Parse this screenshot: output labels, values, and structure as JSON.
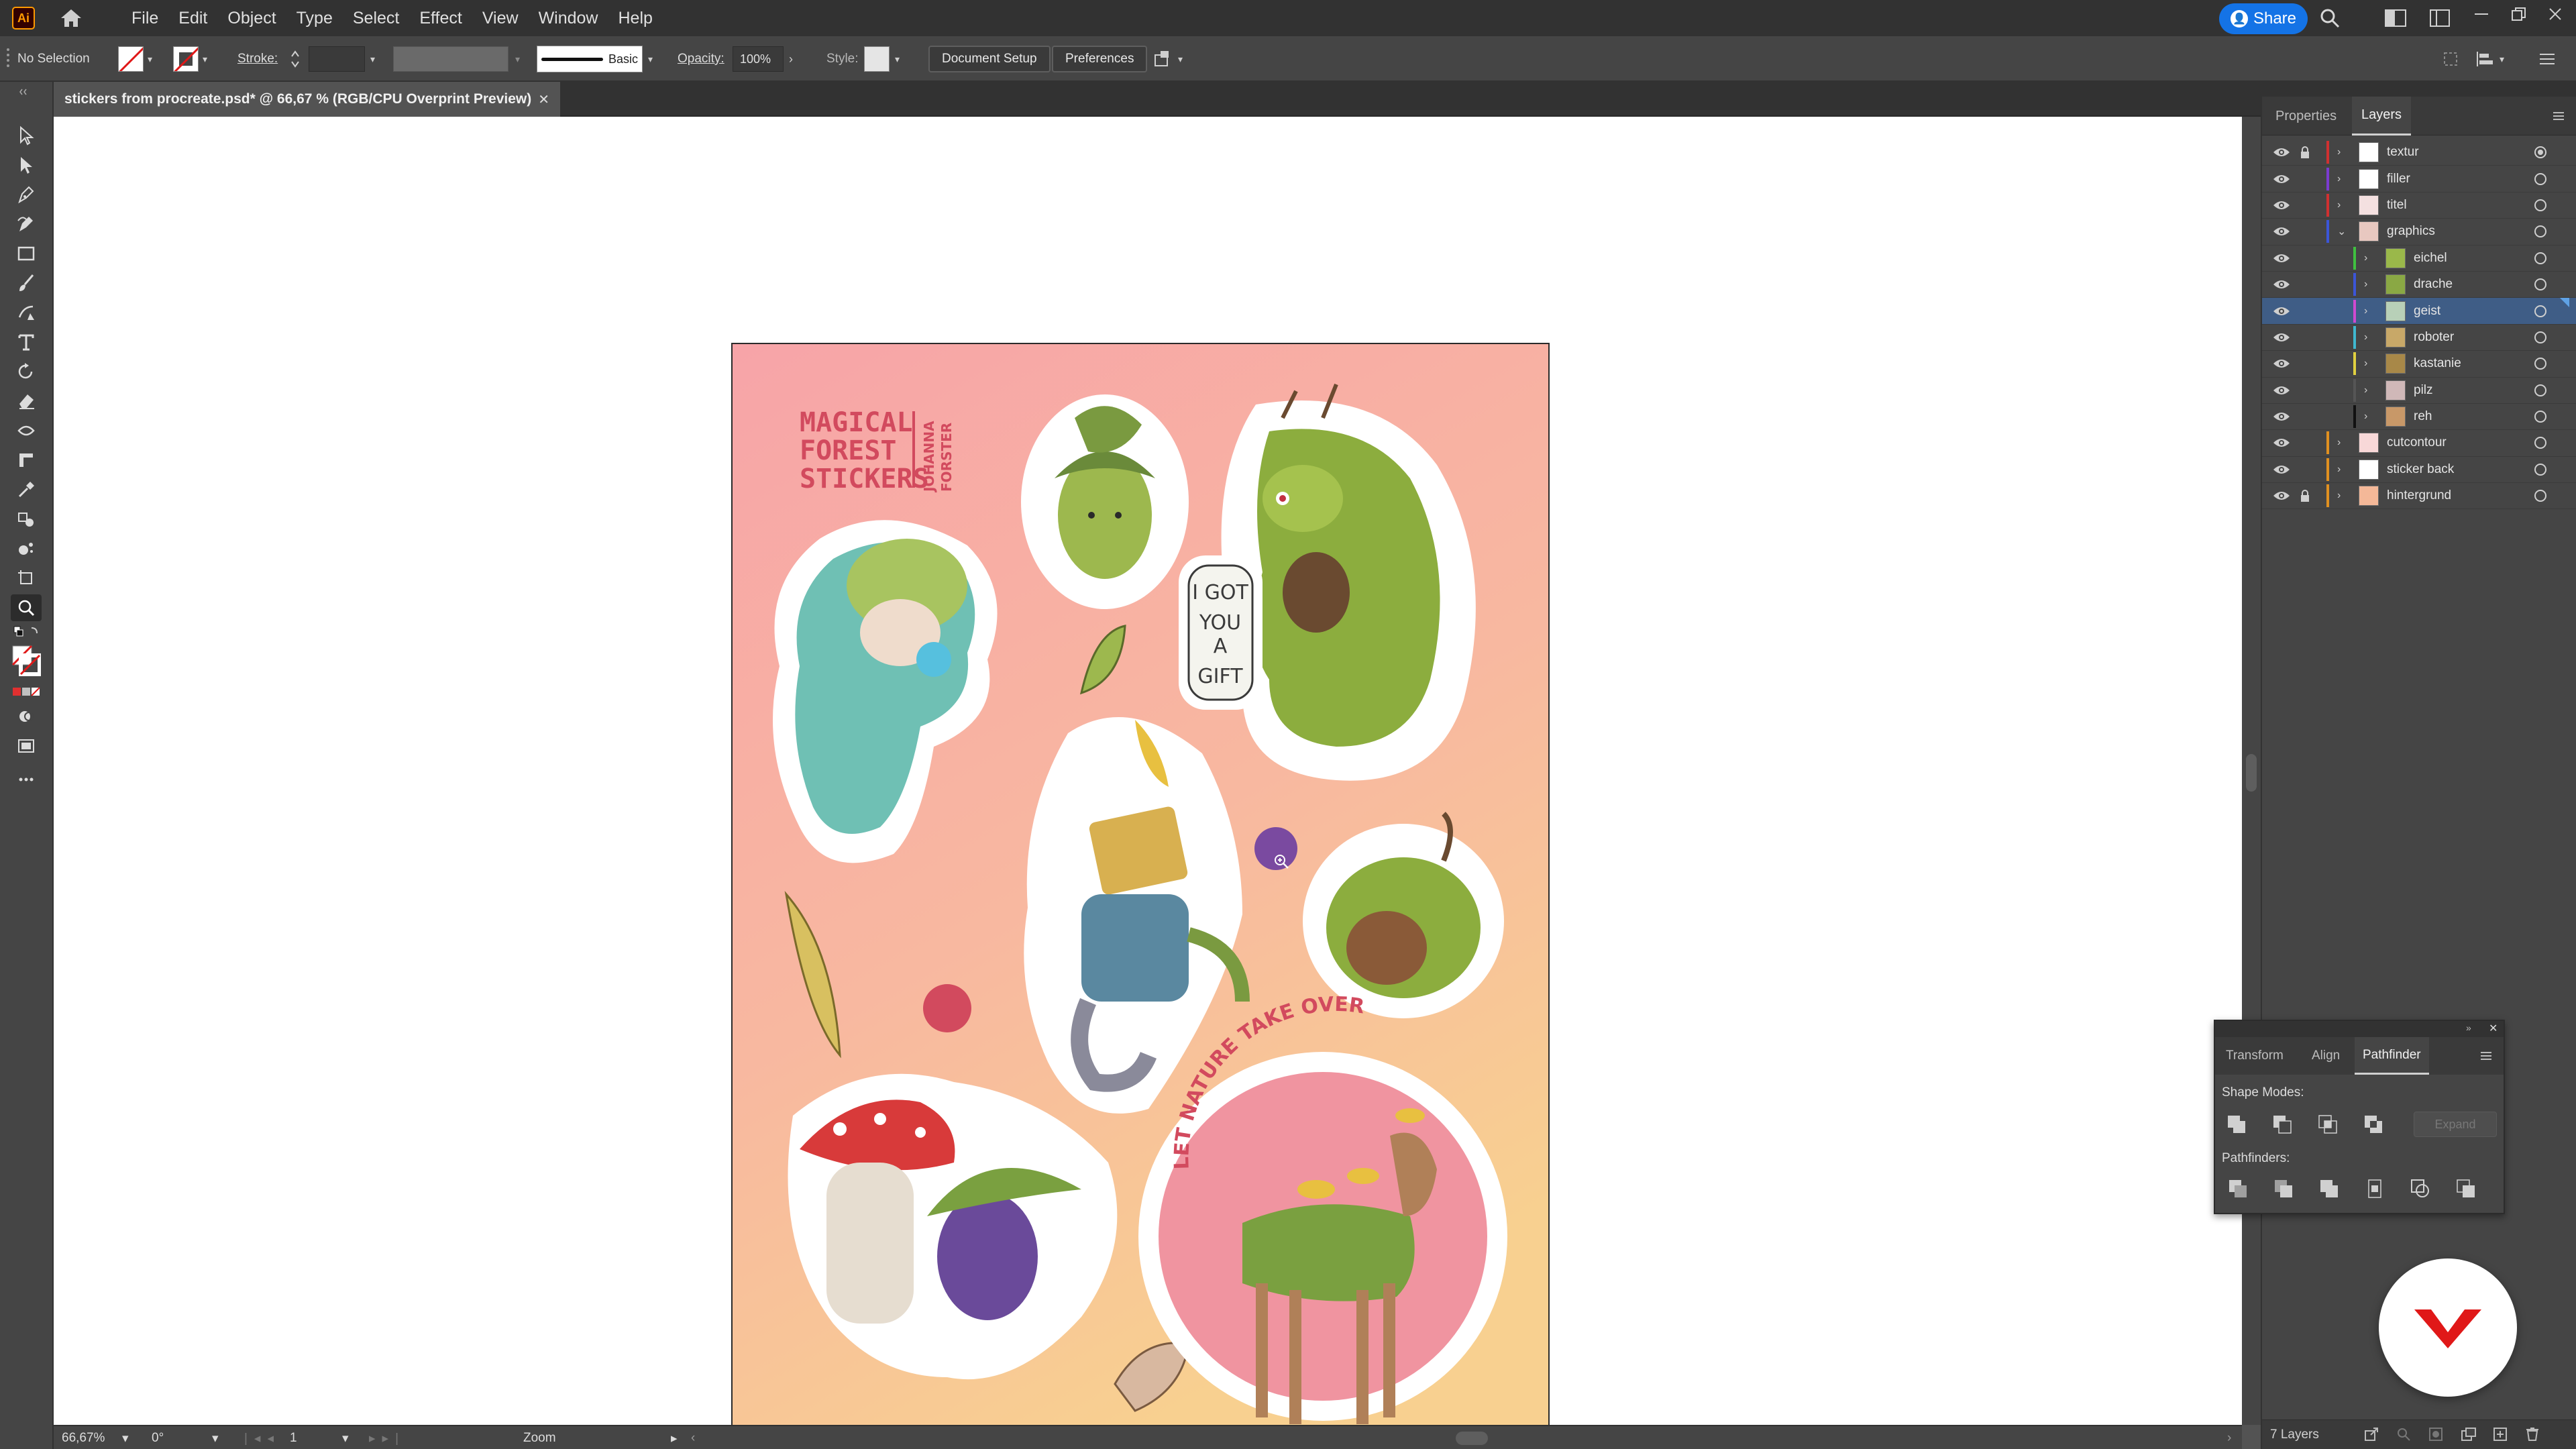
{
  "app": {
    "logo_text": "Ai"
  },
  "menu": [
    "File",
    "Edit",
    "Object",
    "Type",
    "Select",
    "Effect",
    "View",
    "Window",
    "Help"
  ],
  "share": {
    "label": "Share"
  },
  "control_bar": {
    "selection": "No Selection",
    "stroke_label": "Stroke:",
    "brush_label": "Basic",
    "opacity_label": "Opacity:",
    "opacity_value": "100%",
    "style_label": "Style:",
    "document_setup": "Document Setup",
    "preferences": "Preferences"
  },
  "document": {
    "tab_title": "stickers from procreate.psd* @ 66,67 % (RGB/CPU Overprint Preview)",
    "close": "✕"
  },
  "artwork": {
    "title_lines": [
      "MAGICAL",
      "FOREST",
      "STICKERS"
    ],
    "signature_lines": [
      "JOHANNA",
      "FORSTER"
    ],
    "speech_lines": [
      "I GOT",
      "YOU",
      "A",
      "GIFT"
    ],
    "banner": "LET NATURE TAKE OVER"
  },
  "status": {
    "zoom": "66,67%",
    "rotation": "0°",
    "artboard": "1",
    "tool": "Zoom"
  },
  "panel": {
    "tabs": [
      "Properties",
      "Layers"
    ],
    "active_tab": "Layers",
    "layers": [
      {
        "name": "textur",
        "color": "#d03030",
        "indent": 0,
        "locked": true,
        "thumb": "#ffffff",
        "expanded": false,
        "selected": false
      },
      {
        "name": "filler",
        "color": "#7b3bd0",
        "indent": 0,
        "locked": false,
        "thumb": "#ffffff",
        "expanded": false,
        "selected": false
      },
      {
        "name": "titel",
        "color": "#d03030",
        "indent": 0,
        "locked": false,
        "thumb": "#f4e0e0",
        "expanded": false,
        "selected": false
      },
      {
        "name": "graphics",
        "color": "#3b55d8",
        "indent": 0,
        "locked": false,
        "thumb": "#e8c8c0",
        "expanded": true,
        "selected": false
      },
      {
        "name": "eichel",
        "color": "#3fc040",
        "indent": 1,
        "locked": false,
        "thumb": "#9ab84a",
        "expanded": false,
        "selected": false
      },
      {
        "name": "drache",
        "color": "#3b55d8",
        "indent": 1,
        "locked": false,
        "thumb": "#8aa844",
        "expanded": false,
        "selected": false
      },
      {
        "name": "geist",
        "color": "#d04ad0",
        "indent": 1,
        "locked": false,
        "thumb": "#b8d0b8",
        "expanded": false,
        "selected": true
      },
      {
        "name": "roboter",
        "color": "#3fb8d0",
        "indent": 1,
        "locked": false,
        "thumb": "#c8a868",
        "expanded": false,
        "selected": false
      },
      {
        "name": "kastanie",
        "color": "#e0d040",
        "indent": 1,
        "locked": false,
        "thumb": "#a88848",
        "expanded": false,
        "selected": false
      },
      {
        "name": "pilz",
        "color": "#555555",
        "indent": 1,
        "locked": false,
        "thumb": "#d0b8b8",
        "expanded": false,
        "selected": false
      },
      {
        "name": "reh",
        "color": "#111111",
        "indent": 1,
        "locked": false,
        "thumb": "#c89868",
        "expanded": false,
        "selected": false
      },
      {
        "name": "cutcontour",
        "color": "#e09020",
        "indent": 0,
        "locked": false,
        "thumb": "#f8d8d8",
        "expanded": false,
        "selected": false
      },
      {
        "name": "sticker back",
        "color": "#e09020",
        "indent": 0,
        "locked": false,
        "thumb": "#ffffff",
        "expanded": false,
        "selected": false
      },
      {
        "name": "hintergrund",
        "color": "#e09020",
        "indent": 0,
        "locked": true,
        "thumb": "#f4b898",
        "expanded": false,
        "selected": false
      }
    ],
    "footer": "7 Layers"
  },
  "pathfinder": {
    "tabs": [
      "Transform",
      "Align",
      "Pathfinder"
    ],
    "active_tab": "Pathfinder",
    "shape_modes_label": "Shape Modes:",
    "pathfinders_label": "Pathfinders:",
    "expand_label": "Expand"
  },
  "colors": {
    "accent": "#1473e6",
    "selection": "#3f5d86",
    "artboard_bg_top": "#f6a8a8",
    "artboard_bg_bottom": "#f8d090"
  }
}
